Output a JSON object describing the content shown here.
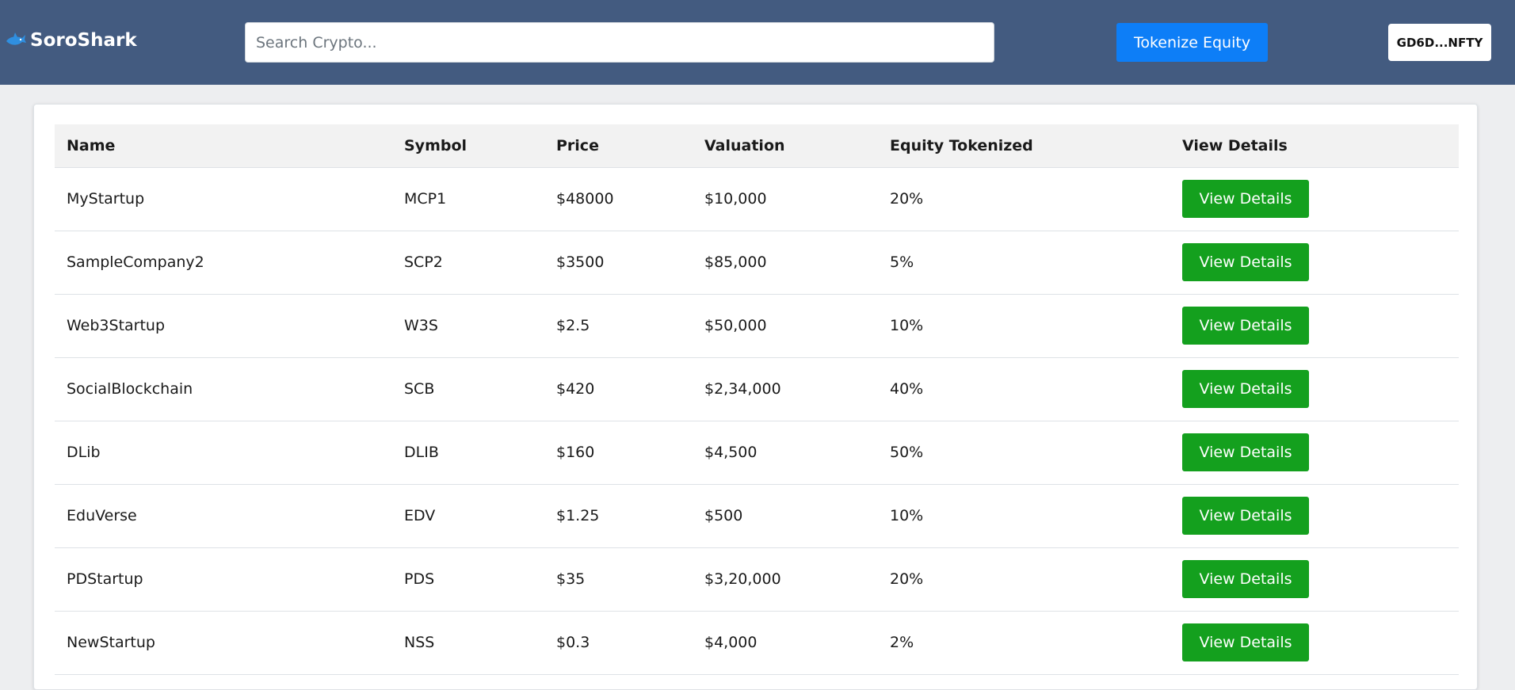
{
  "navbar": {
    "brand": "SoroShark",
    "brand_icon": "shark-icon",
    "search_placeholder": "Search Crypto...",
    "tokenize_label": "Tokenize Equity",
    "wallet_label": "GD6D...NFTY",
    "colors": {
      "navbar_bg": "#435b80",
      "tokenize_bg": "#0d7ef7",
      "view_btn_bg": "#14a01e"
    }
  },
  "table": {
    "headers": [
      "Name",
      "Symbol",
      "Price",
      "Valuation",
      "Equity Tokenized",
      "View Details"
    ],
    "rows": [
      {
        "name": "MyStartup",
        "symbol": "MCP1",
        "price": "$48000",
        "valuation": "$10,000",
        "equity": "20%",
        "action": "View Details"
      },
      {
        "name": "SampleCompany2",
        "symbol": "SCP2",
        "price": "$3500",
        "valuation": "$85,000",
        "equity": "5%",
        "action": "View Details"
      },
      {
        "name": "Web3Startup",
        "symbol": "W3S",
        "price": "$2.5",
        "valuation": "$50,000",
        "equity": "10%",
        "action": "View Details"
      },
      {
        "name": "SocialBlockchain",
        "symbol": "SCB",
        "price": "$420",
        "valuation": "$2,34,000",
        "equity": "40%",
        "action": "View Details"
      },
      {
        "name": "DLib",
        "symbol": "DLIB",
        "price": "$160",
        "valuation": "$4,500",
        "equity": "50%",
        "action": "View Details"
      },
      {
        "name": "EduVerse",
        "symbol": "EDV",
        "price": "$1.25",
        "valuation": "$500",
        "equity": "10%",
        "action": "View Details"
      },
      {
        "name": "PDStartup",
        "symbol": "PDS",
        "price": "$35",
        "valuation": "$3,20,000",
        "equity": "20%",
        "action": "View Details"
      },
      {
        "name": "NewStartup",
        "symbol": "NSS",
        "price": "$0.3",
        "valuation": "$4,000",
        "equity": "2%",
        "action": "View Details"
      }
    ]
  }
}
